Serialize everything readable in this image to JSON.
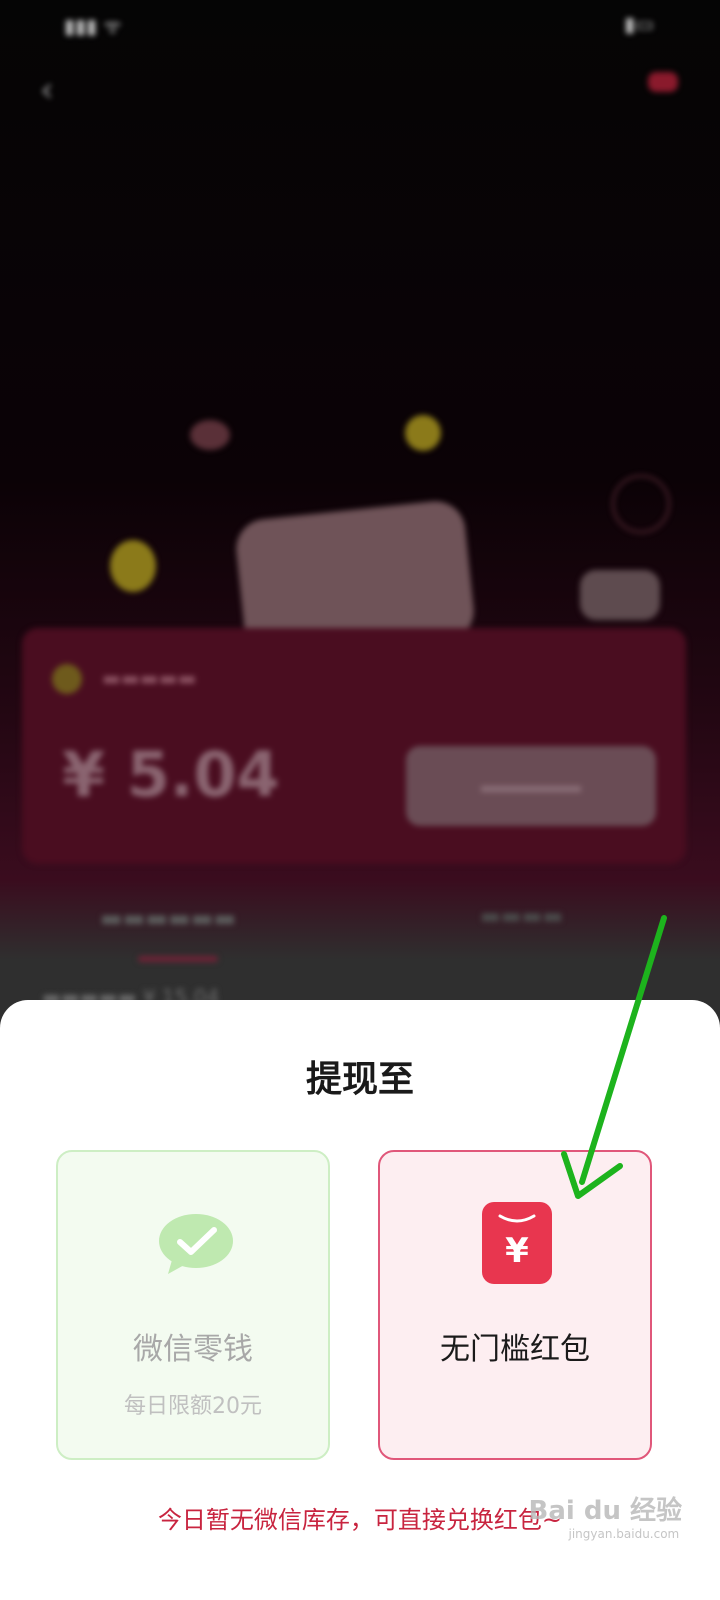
{
  "colors": {
    "accent_red": "#E8364F",
    "wechat_green": "#7FD36A",
    "notice_red": "#C8243F",
    "annotation_green": "#1DB31D"
  },
  "background": {
    "balance": {
      "amount": "¥ 5.04"
    },
    "week_stats": {
      "amount": "¥ 15.04"
    }
  },
  "sheet": {
    "title": "提现至",
    "options": [
      {
        "id": "wechat",
        "icon": "wechat-icon",
        "title": "微信零钱",
        "subtitle": "每日限额20元",
        "enabled": false
      },
      {
        "id": "redpacket",
        "icon": "red-packet-icon",
        "title": "无门槛红包",
        "selected": true
      }
    ],
    "notice": "今日暂无微信库存，可直接兑换红包~"
  },
  "watermark": {
    "brand": "Bai du 经验",
    "url": "jingyan.baidu.com"
  }
}
